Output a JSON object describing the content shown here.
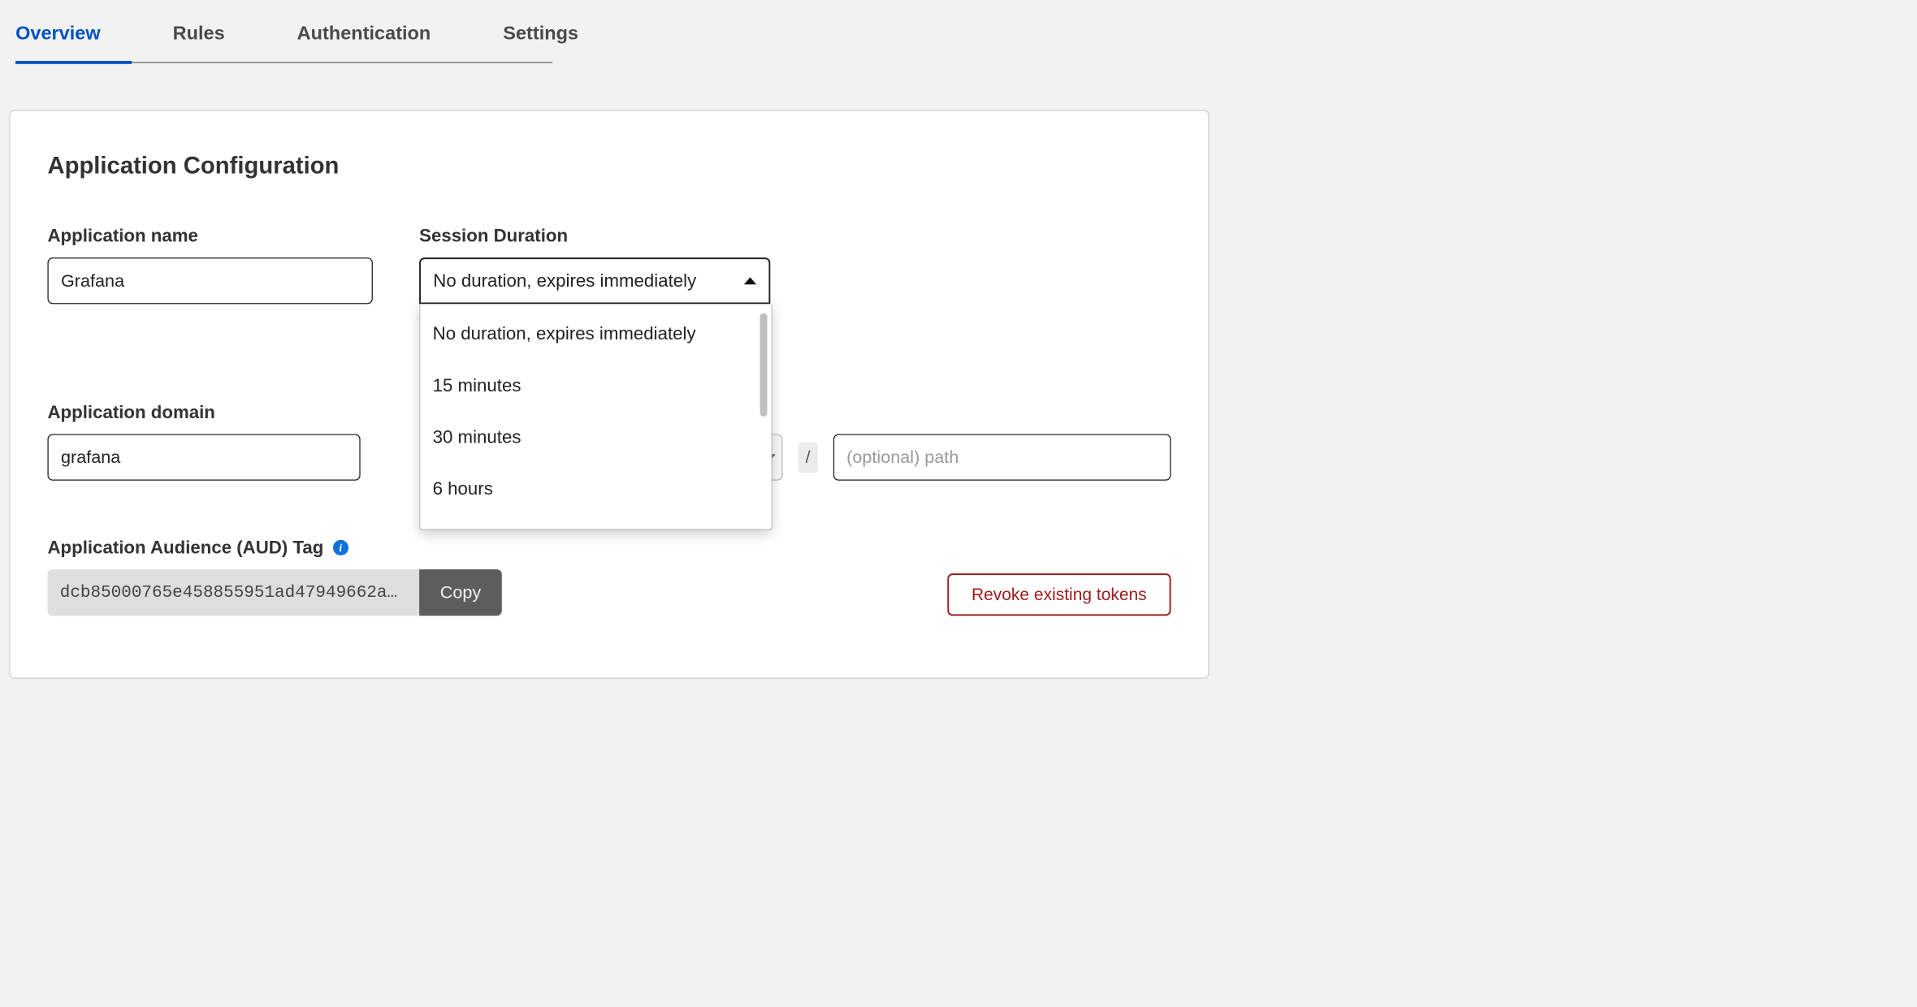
{
  "tabs": [
    {
      "label": "Overview",
      "active": true
    },
    {
      "label": "Rules",
      "active": false
    },
    {
      "label": "Authentication",
      "active": false
    },
    {
      "label": "Settings",
      "active": false
    }
  ],
  "card": {
    "title": "Application Configuration",
    "app_name": {
      "label": "Application name",
      "value": "Grafana"
    },
    "session_duration": {
      "label": "Session Duration",
      "selected": "No duration, expires immediately",
      "options": [
        "No duration, expires immediately",
        "15 minutes",
        "30 minutes",
        "6 hours"
      ]
    },
    "app_domain": {
      "label": "Application domain",
      "subdomain_value": "grafana",
      "separator": "/",
      "path_placeholder": "(optional) path"
    },
    "aud": {
      "label": "Application Audience (AUD) Tag",
      "value": "dcb85000765e458855951ad47949662a…",
      "copy_label": "Copy"
    },
    "revoke_label": "Revoke existing tokens"
  }
}
